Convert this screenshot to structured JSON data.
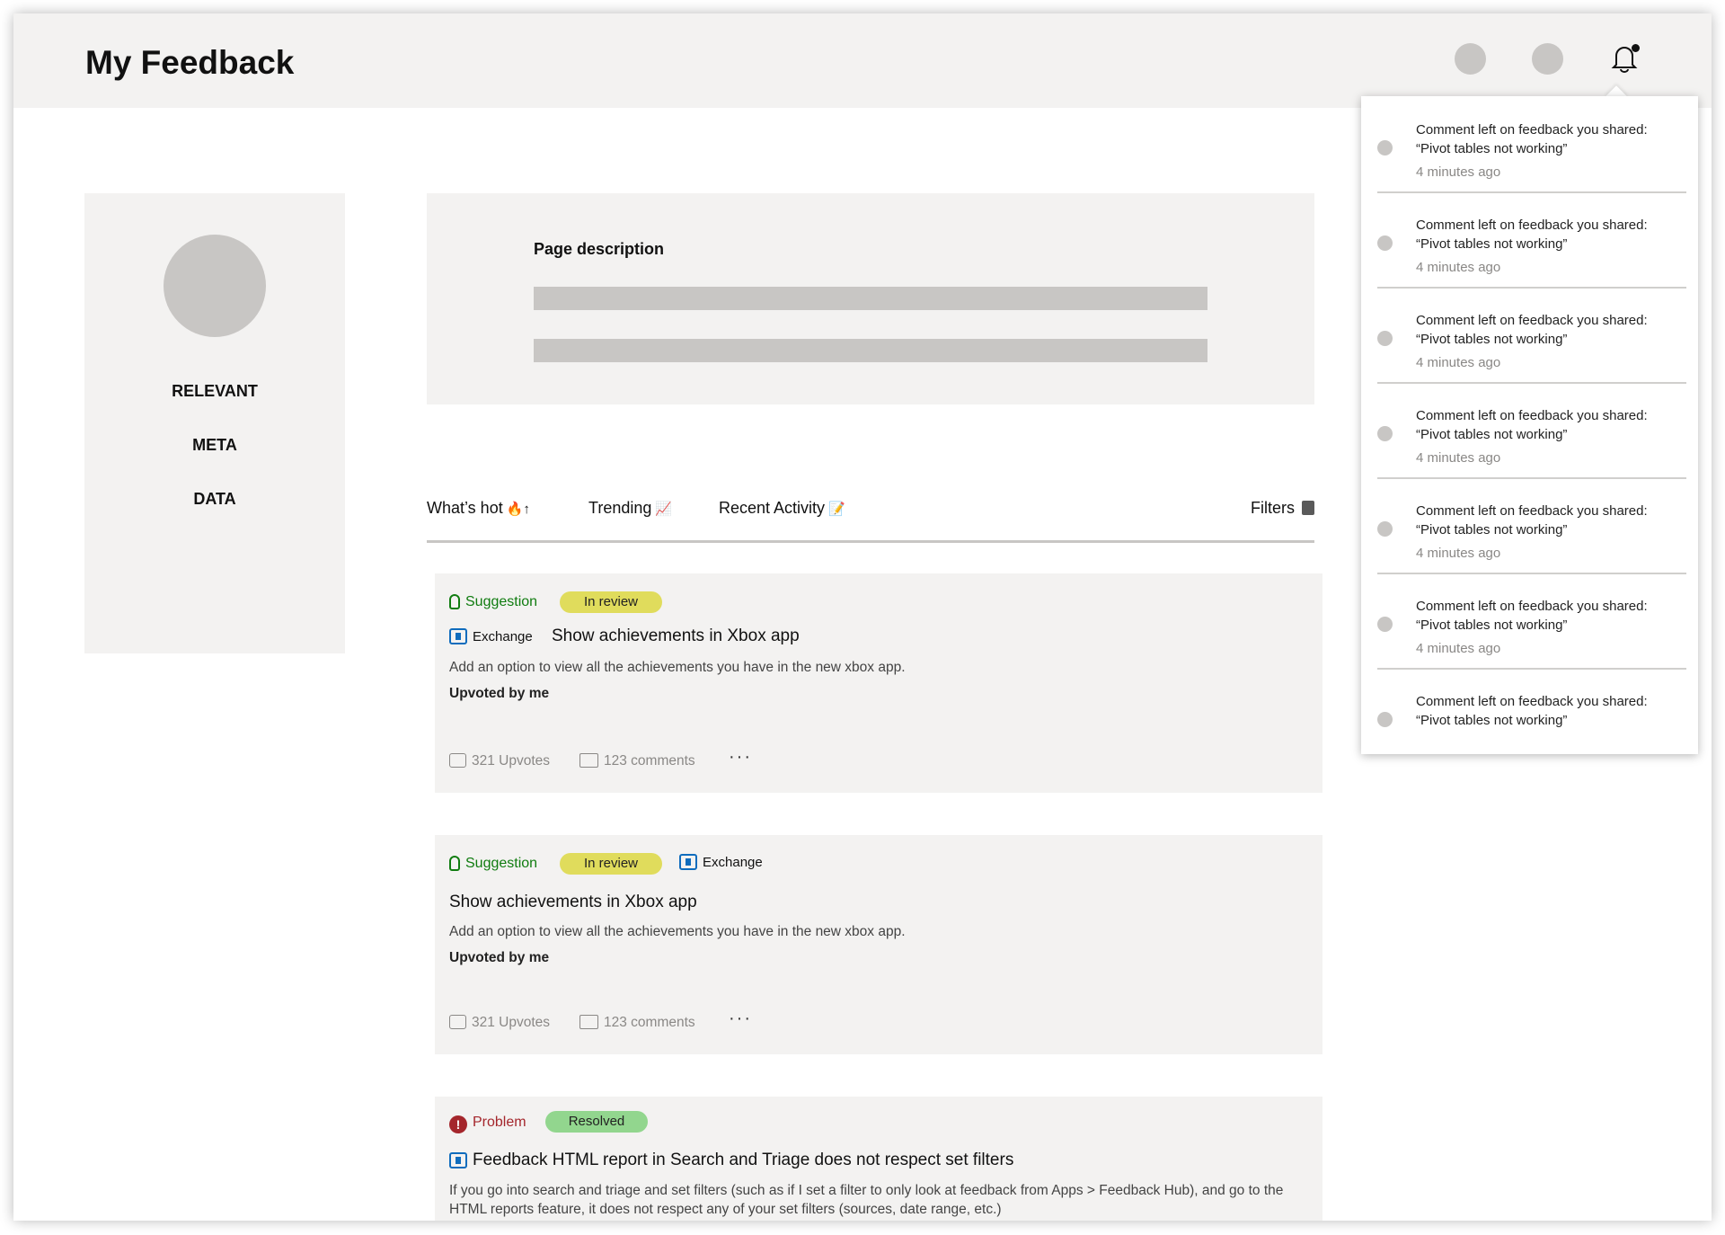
{
  "header": {
    "title": "My Feedback",
    "buttons": [
      "profile-circle",
      "settings-circle"
    ],
    "bell_icon": "bell-icon"
  },
  "sidebar": {
    "meta_lines": [
      "RELEVANT",
      "META",
      "DATA"
    ]
  },
  "description": {
    "title": "Page description"
  },
  "tabs": {
    "whats_hot": "What’s hot",
    "whats_hot_glyph": "🔥↑",
    "trending": "Trending",
    "trending_glyph": "📈",
    "recent": "Recent Activity",
    "recent_glyph": "📝",
    "filters": "Filters"
  },
  "cards": [
    {
      "type": "Suggestion",
      "status": "In review",
      "app": "Exchange",
      "title": "Show achievements in Xbox app",
      "body": "Add an option to view all the achievements you have in the new xbox app.",
      "upvoted": "Upvoted by me",
      "upvotes": "321 Upvotes",
      "comments": "123 comments",
      "more": "···"
    },
    {
      "type": "Suggestion",
      "status": "In review",
      "app": "Exchange",
      "title": "Show achievements in Xbox app",
      "body": "Add an option to view all the achievements you have in the new xbox app.",
      "upvoted": "Upvoted by me",
      "upvotes": "321 Upvotes",
      "comments": "123 comments",
      "more": "···"
    },
    {
      "type": "Problem",
      "status": "Resolved",
      "title": "Feedback HTML report in Search and Triage does not respect set filters",
      "body": "If you go into search and triage and set filters (such as if I set a filter to only look at feedback from Apps > Feedback Hub), and go to the HTML reports feature, it does not respect any of your set filters (sources, date range, etc.)"
    }
  ],
  "notifications": [
    {
      "text": "Comment left on feedback you shared: “Pivot tables not working”",
      "time": "4 minutes ago"
    },
    {
      "text": "Comment left on feedback you shared: “Pivot tables not working”",
      "time": "4 minutes ago"
    },
    {
      "text": "Comment left on feedback you shared: “Pivot tables not working”",
      "time": "4 minutes ago"
    },
    {
      "text": "Comment left on feedback you shared: “Pivot tables not working”",
      "time": "4 minutes ago"
    },
    {
      "text": "Comment left on feedback you shared: “Pivot tables not working”",
      "time": "4 minutes ago"
    },
    {
      "text": "Comment left on feedback you shared: “Pivot tables not working”",
      "time": "4 minutes ago"
    },
    {
      "text": "Comment left on feedback you shared: “Pivot tables not working”",
      "time": ""
    }
  ],
  "colors": {
    "suggestion": "#107c10",
    "problem": "#a4262c",
    "in_review": "#e0dc5c",
    "resolved": "#92d68e",
    "panel": "#f3f2f1",
    "placeholder": "#c8c6c4"
  }
}
